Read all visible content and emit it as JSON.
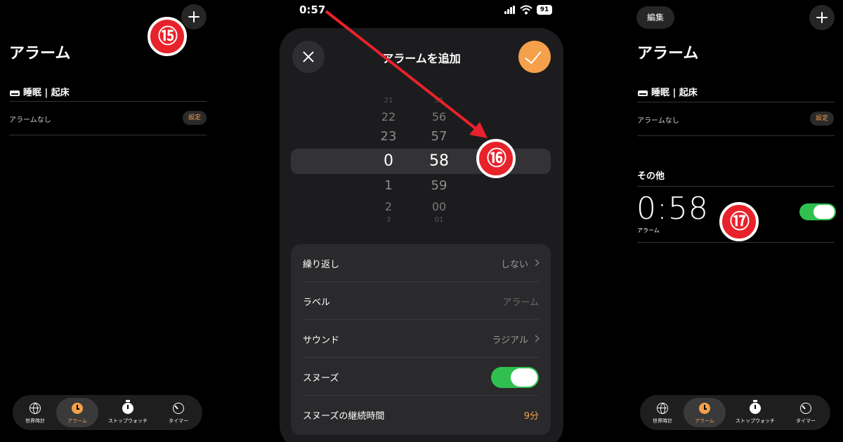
{
  "panel1": {
    "title": "アラーム",
    "sleep_section": "睡眠 | 起床",
    "no_alarm": "アラームなし",
    "set_button": "設定",
    "badge": "⑮"
  },
  "panel2": {
    "status_time": "0:57",
    "battery": "91",
    "sheet_title": "アラームを追加",
    "picker": {
      "hours": [
        "21",
        "22",
        "23",
        "0",
        "1",
        "2",
        "3"
      ],
      "minutes": [
        "55",
        "56",
        "57",
        "58",
        "59",
        "00",
        "01"
      ],
      "selected_hour": "0",
      "selected_minute": "58"
    },
    "settings": {
      "repeat_label": "繰り返し",
      "repeat_value": "しない",
      "label_label": "ラベル",
      "label_placeholder": "アラーム",
      "sound_label": "サウンド",
      "sound_value": "ラジアル",
      "snooze_label": "スヌーズ",
      "snooze_on": true,
      "snooze_duration_label": "スヌーズの継続時間",
      "snooze_duration_value": "9分"
    },
    "badge": "⑯"
  },
  "panel3": {
    "edit_button": "編集",
    "title": "アラーム",
    "sleep_section": "睡眠 | 起床",
    "no_alarm": "アラームなし",
    "set_button": "設定",
    "other_section": "その他",
    "alarm_time": "0:58",
    "alarm_label": "アラーム",
    "alarm_on": true,
    "badge": "⑰"
  },
  "tabbar": {
    "world_clock": "世界時計",
    "alarm": "アラーム",
    "stopwatch": "ストップウォッチ",
    "timer": "タイマー"
  },
  "colors": {
    "accent": "#f5a04a",
    "toggle_on": "#30c04f",
    "badge_red": "#e8222a",
    "arrow_red": "#e8222a"
  }
}
